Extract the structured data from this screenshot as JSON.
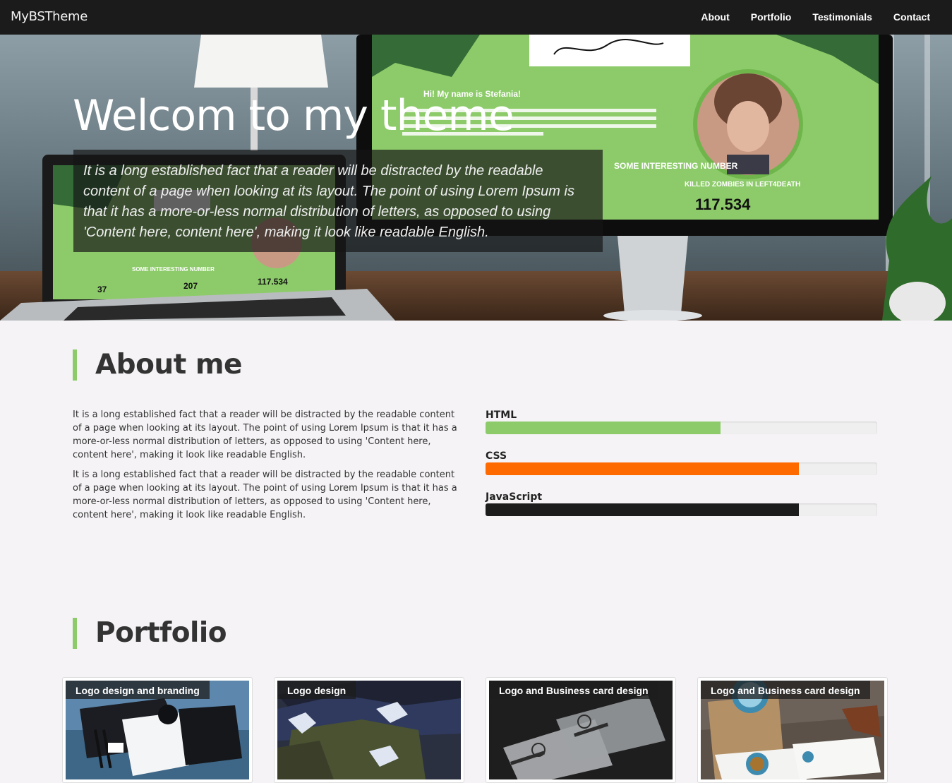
{
  "navbar": {
    "brand": "MyBSTheme",
    "links": [
      "About",
      "Portfolio",
      "Testimonials",
      "Contact"
    ]
  },
  "hero": {
    "title": "Welcom to my theme",
    "text": "It is a long established fact that a reader will be distracted by the readable content of a page when looking at its layout. The point of using Lorem Ipsum is that it has a more-or-less normal distribution of letters, as opposed to using 'Content here, content here', making it look like readable English.",
    "image": {
      "greeting": "Hi! My name is Stefania!",
      "monitor_label": "KILLED ZOMBIES IN LEFT4DEATH",
      "monitor_value": "117.534",
      "section_label": "SOME INTERESTING NUMBER",
      "laptop_values": [
        "37",
        "207",
        "117.534"
      ]
    }
  },
  "about": {
    "heading": "About me",
    "paragraphs": [
      "It is a long established fact that a reader will be distracted by the readable content of a page when looking at its layout. The point of using Lorem Ipsum is that it has a more-or-less normal distribution of letters, as opposed to using 'Content here, content here', making it look like readable English.",
      "It is a long established fact that a reader will be distracted by the readable content of a page when looking at its layout. The point of using Lorem Ipsum is that it has a more-or-less normal distribution of letters, as opposed to using 'Content here, content here', making it look like readable English."
    ],
    "skills": [
      {
        "name": "HTML",
        "percent": 60,
        "color": "#8dcb6a"
      },
      {
        "name": "CSS",
        "percent": 80,
        "color": "#ff6a00"
      },
      {
        "name": "JavaScript",
        "percent": 80,
        "color": "#1c1c1c"
      }
    ]
  },
  "portfolio": {
    "heading": "Portfolio",
    "items": [
      {
        "caption": "Logo design and branding"
      },
      {
        "caption": "Logo design"
      },
      {
        "caption": "Logo and Business card design"
      },
      {
        "caption": "Logo and Business card design"
      }
    ]
  },
  "colors": {
    "accent": "#8dcb6a",
    "navbar": "#1c1b1c",
    "page_background": "#f5f3f5"
  }
}
